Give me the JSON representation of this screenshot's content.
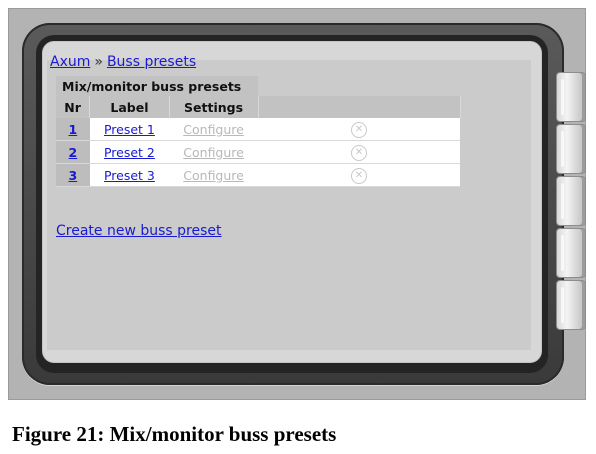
{
  "breadcrumb": {
    "root": "Axum",
    "separator": "»",
    "current": "Buss presets"
  },
  "table": {
    "caption": "Mix/monitor buss presets",
    "headers": {
      "nr": "Nr",
      "label": "Label",
      "settings": "Settings"
    },
    "rows": [
      {
        "nr": "1",
        "label": "Preset 1",
        "settings": "Configure",
        "delete_icon": "x-circle-icon"
      },
      {
        "nr": "2",
        "label": "Preset 2",
        "settings": "Configure",
        "delete_icon": "x-circle-icon"
      },
      {
        "nr": "3",
        "label": "Preset 3",
        "settings": "Configure",
        "delete_icon": "x-circle-icon"
      }
    ]
  },
  "actions": {
    "create_label": "Create new buss preset"
  },
  "figure_caption": "Figure 21: Mix/monitor buss presets",
  "colors": {
    "link": "#1a1ad0",
    "disabled_link": "#b8b8b8",
    "panel": "#cbcbcb",
    "bezel": "#3a3a3a"
  }
}
